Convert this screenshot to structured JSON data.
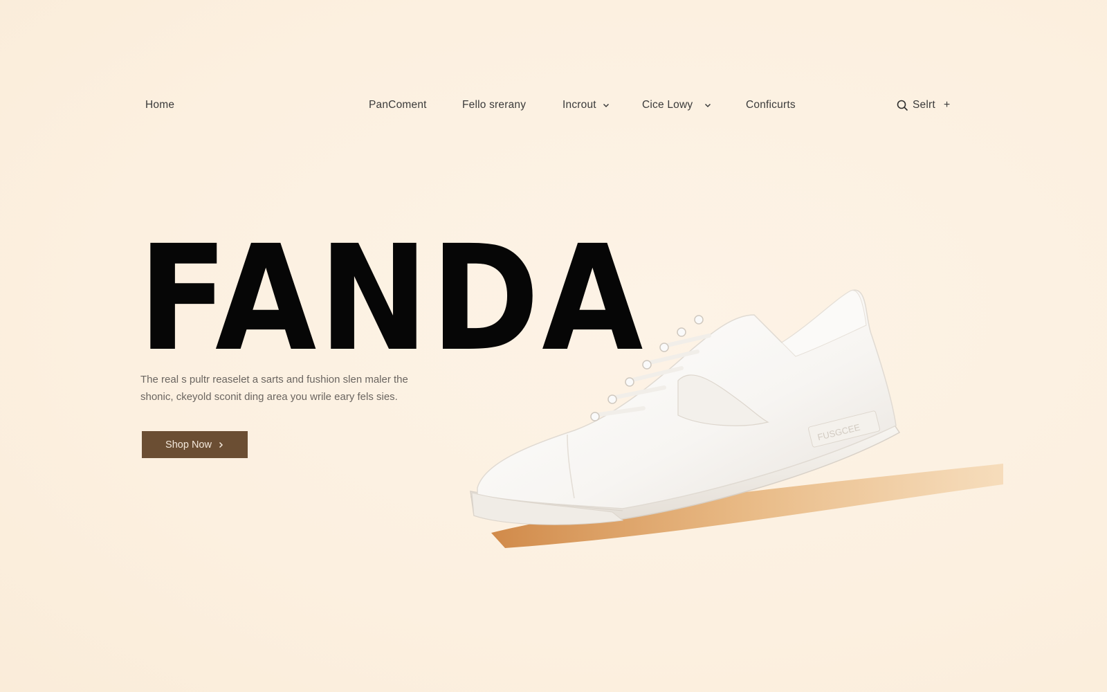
{
  "nav": {
    "home": "Home",
    "items": [
      {
        "label": "PanComent",
        "has_dropdown": false
      },
      {
        "label": "Fello srerany",
        "has_dropdown": false
      },
      {
        "label": "Incrout",
        "has_dropdown": true
      },
      {
        "label": "Cice Lowy",
        "has_dropdown": true
      },
      {
        "label": "Conficurts",
        "has_dropdown": false
      }
    ],
    "search_label": "Selrt",
    "search_icon": "search-icon",
    "plus_icon": "plus-icon"
  },
  "hero": {
    "title": "FANDA",
    "description_line1": "The real s pultr reaselet a sarts and fushion slen maler the",
    "description_line2": "shonic, ckeyold sconit ding area you wrile eary fels sies.",
    "cta_label": "Shop Now",
    "sneaker_brand_text": "FUSGCEE"
  },
  "colors": {
    "background": "#fdf2e4",
    "title": "#060606",
    "cta_bg": "#6b4e33",
    "cta_text": "#f4e9dc",
    "shadow": "#d99a55"
  }
}
